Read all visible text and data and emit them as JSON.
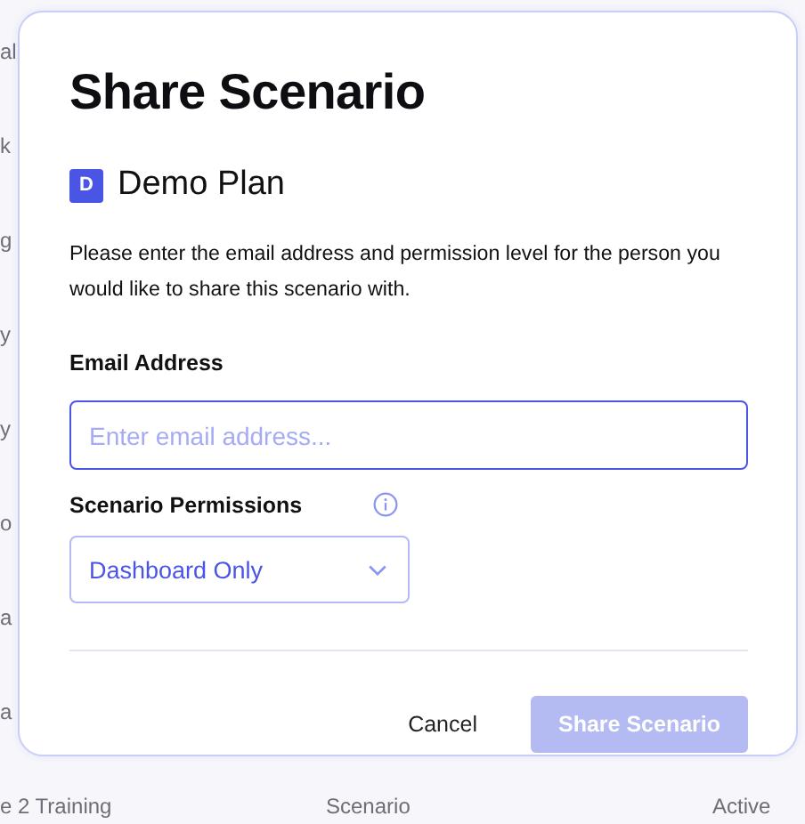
{
  "table": {
    "rows": [
      {
        "name": "al"
      },
      {
        "name": "k"
      },
      {
        "name": "g"
      },
      {
        "name": "y"
      },
      {
        "name": "y"
      },
      {
        "name": "o"
      },
      {
        "name": "a"
      },
      {
        "name": "a"
      },
      {
        "name": "e 2 Training",
        "type": "Scenario",
        "status": "Active"
      }
    ]
  },
  "dialog": {
    "title": "Share Scenario",
    "plan": {
      "badge": "D",
      "name": "Demo Plan"
    },
    "description": "Please enter the email address and permission level for the person you would like to share this scenario with.",
    "email": {
      "label": "Email Address",
      "placeholder": "Enter email address..."
    },
    "permissions": {
      "label": "Scenario Permissions",
      "value": "Dashboard Only"
    },
    "buttons": [
      {
        "label": "Cancel",
        "kind": "secondary",
        "disabled": false
      },
      {
        "label": "Share Scenario",
        "kind": "primary",
        "disabled": true
      }
    ]
  }
}
